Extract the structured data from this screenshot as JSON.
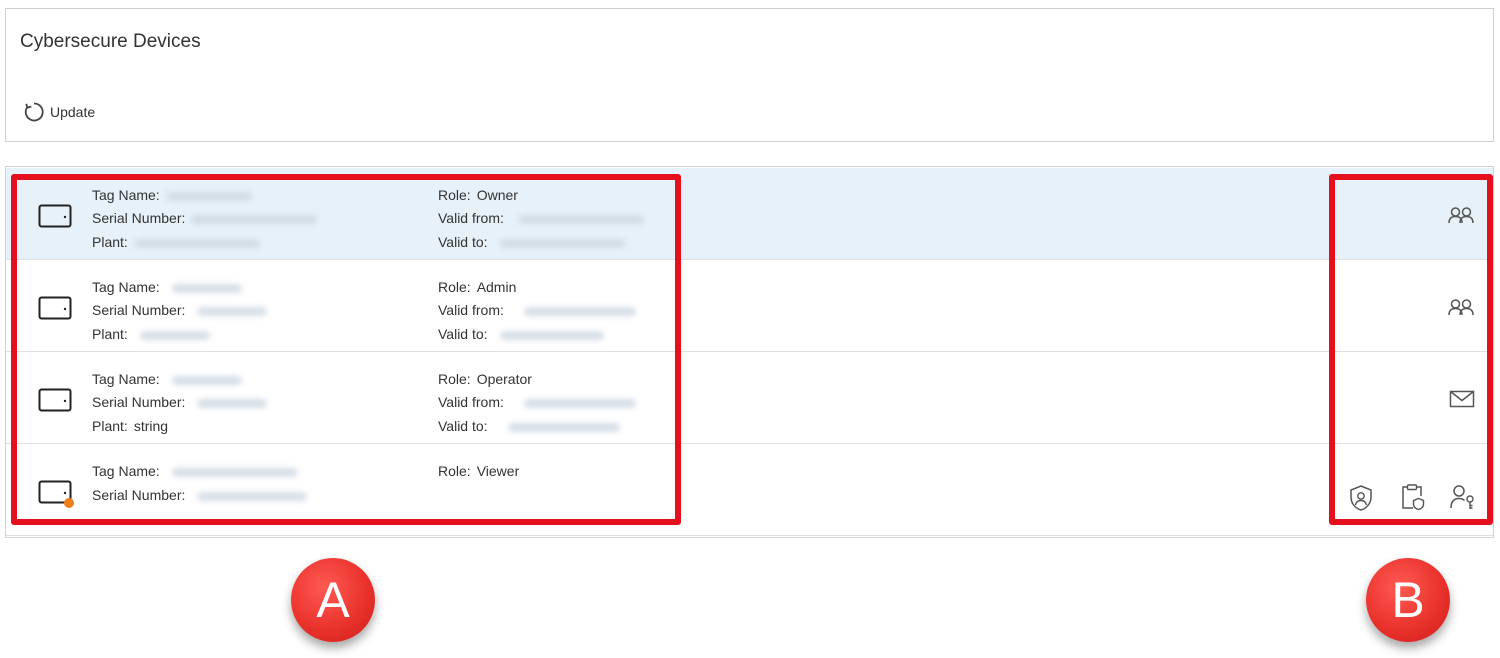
{
  "header": {
    "title": "Cybersecure Devices",
    "update_label": "Update"
  },
  "labels": {
    "tag_name": "Tag Name:",
    "serial_number": "Serial Number:",
    "plant": "Plant:",
    "role": "Role:",
    "valid_from": "Valid from:",
    "valid_to": "Valid to:"
  },
  "devices": [
    {
      "role": "Owner",
      "plant_value": "",
      "actions": [
        "users-icon"
      ],
      "selected": true
    },
    {
      "role": "Admin",
      "plant_value": "",
      "actions": [
        "users-icon"
      ]
    },
    {
      "role": "Operator",
      "plant_value": "string",
      "actions": [
        "mail-icon"
      ]
    },
    {
      "role": "Viewer",
      "actions": [
        "shield-user-icon",
        "clipboard-shield-icon",
        "user-key-icon"
      ],
      "status_dot_color": "#f07e1a"
    }
  ],
  "callouts": {
    "a": "A",
    "b": "B"
  },
  "colors": {
    "highlight": "#e5101e",
    "selected_row": "#e6f1f9",
    "callout": "#e8302a"
  }
}
